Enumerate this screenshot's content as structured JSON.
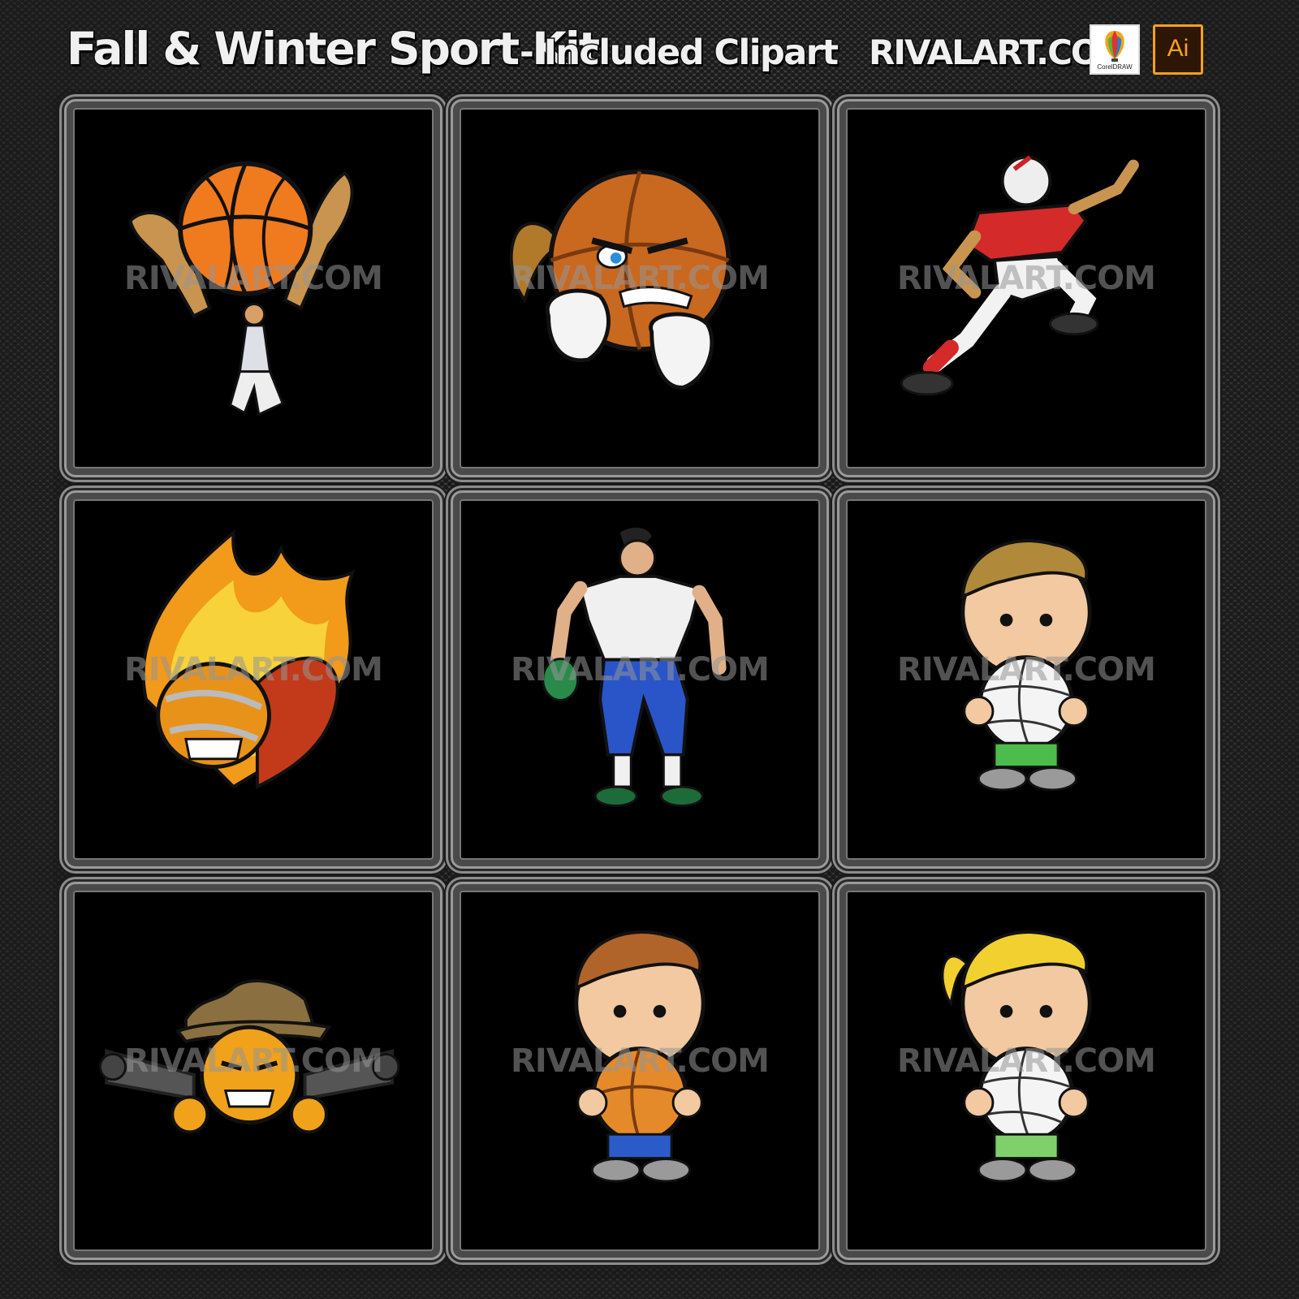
{
  "header": {
    "title": "Fall & Winter Sport Kit",
    "subtitle": "- Included Clipart",
    "site": "RIVALART.COM",
    "corel_logo_text": "CorelDRAW",
    "ai_logo_text": "Ai"
  },
  "watermark": "RIVALART.COM",
  "colors": {
    "background": "#3a3a3a",
    "cell_background": "#000000",
    "frame": "#9a9a9a",
    "ai_orange": "#f7a11a"
  },
  "clipart": [
    {
      "icon": "basketball-dunk-hands-icon"
    },
    {
      "icon": "angry-basketball-fists-icon"
    },
    {
      "icon": "football-player-running-icon"
    },
    {
      "icon": "flaming-football-helmet-icon"
    },
    {
      "icon": "football-player-standing-icon"
    },
    {
      "icon": "boy-with-volleyball-icon"
    },
    {
      "icon": "cowboy-ball-pistols-icon"
    },
    {
      "icon": "boy-with-basketball-icon"
    },
    {
      "icon": "girl-with-volleyball-icon"
    }
  ]
}
